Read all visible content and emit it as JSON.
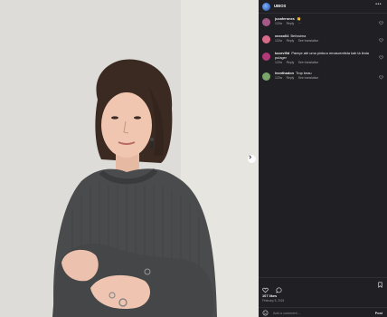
{
  "post": {
    "username": "UBIOS",
    "likes": "107 likes",
    "date": "February 5, 2024",
    "add_comment_placeholder": "Add a comment...",
    "post_label": "Post"
  },
  "comments": [
    {
      "user": "jucafernnes",
      "text": "👏",
      "time": "122w",
      "reply": "Reply",
      "translation": "",
      "avatar_color": "#a45a86"
    },
    {
      "user": "xxxxo04",
      "text": "Belíssima",
      "time": "122w",
      "reply": "Reply",
      "translation": "See translation",
      "avatar_color": "#d96a8a"
    },
    {
      "user": "koorvl9d",
      "text": "Pareçe até uma pintura renascentista kah tá linda pulager",
      "time": "122w",
      "reply": "Reply",
      "translation": "See translation",
      "avatar_color": "#b23a7a"
    },
    {
      "user": "leonthadon",
      "text": "Trop beau",
      "time": "122w",
      "reply": "Reply",
      "translation": "See translation",
      "avatar_color": "#7aa56b"
    }
  ]
}
